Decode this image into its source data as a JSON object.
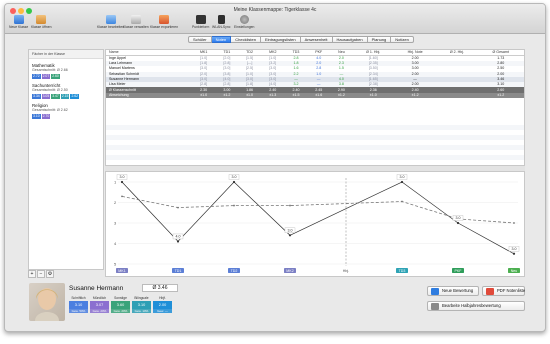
{
  "window": {
    "title": "Meine Klassenmappe: Tigerklasse 4c"
  },
  "toolbar": {
    "left": [
      "Neue Klasse",
      "Klasse öffnen"
    ],
    "middle": [
      "Klasse bearbeiten",
      "Klasse verwalten",
      "Klasse exportieren"
    ],
    "right": [
      "Punkteform",
      "WLAN-Sync",
      "Einstellungen"
    ]
  },
  "tabs": [
    "Schüler",
    "Noten",
    "Checklisten",
    "Eintragungslisten",
    "Anwesenheit",
    "Hausaufgaben",
    "Planung",
    "Notizen"
  ],
  "active_tab": "Noten",
  "sidebar": {
    "header": "Fächer in der Klasse",
    "subjects": [
      {
        "name": "Mathematik",
        "avg": "Gesamtschnitt: Ø 2.66",
        "pills": [
          "2.72",
          "2.07",
          "2.60"
        ]
      },
      {
        "name": "Sachunterricht",
        "avg": "Gesamtschnitt: Ø 2.50",
        "pills": [
          "3.34",
          "3.05",
          "3.47",
          "2.15",
          "2.62"
        ]
      },
      {
        "name": "Religion",
        "avg": "Gesamtschnitt: Ø 2.62",
        "pills": [
          "3.10",
          "2.70"
        ]
      }
    ],
    "footer_buttons": [
      "+",
      "−",
      "⚙"
    ]
  },
  "grid": {
    "columns": [
      "Name",
      "MK1",
      "TD1",
      "TD2",
      "MK2",
      "TD3",
      "PKF",
      "Neu",
      "Ø 1. Hbj.",
      "Hbj. Note",
      "Ø 2. Hbj.",
      "Ø Gesamt"
    ],
    "rows": [
      [
        "Inge Appel",
        "[1.0]",
        "[2.0]",
        "[1.5]",
        "[1.0]",
        "2.8",
        "4.0",
        "2.0",
        "[1.60]",
        "2.00",
        "",
        "1.73"
      ],
      [
        "Lara Lehmann",
        "[1.8]",
        "[2.8]",
        "[—]",
        "[3.2]",
        "1.8",
        "2.0",
        "2.3",
        "[2.35]",
        "3.00",
        "",
        "2.80"
      ],
      [
        "Manuel Martens",
        "[3.0]",
        "[3.0]",
        "[2.5]",
        "[3.0]",
        "1.6",
        "2.8",
        "1.5",
        "[3.50]",
        "3.00",
        "",
        "2.50"
      ],
      [
        "Sebastian Schmidt",
        "[2.0]",
        "[3.8]",
        "[1.0]",
        "[3.0]",
        "2.2",
        "1.0",
        "—",
        "[2.34]",
        "2.00",
        "",
        "2.00"
      ],
      [
        "Susanne Hermann",
        "[3.0]",
        "[4.0]",
        "[3.0]",
        "[3.0]",
        "—",
        "—",
        "4.0",
        "[1.65]",
        "—",
        "",
        "3.46"
      ],
      [
        "Lisa Meier",
        "[2.8]",
        "[2.8]",
        "[1.8]",
        "[4.0]",
        "3.2",
        "—",
        "3.8",
        "[2.38]",
        "2.00",
        "",
        "3.10"
      ]
    ],
    "stat_rows": [
      [
        "Ø Klassenschnitt",
        "2.30",
        "3.00",
        "1.86",
        "2.40",
        "2.40",
        "2.45",
        "2.90",
        "2.36",
        "2.40",
        "",
        "2.60"
      ],
      [
        "Abweichung",
        "±1.0",
        "±1.2",
        "±1.0",
        "±1.3",
        "±1.5",
        "±1.6",
        "±1.2",
        "±1.0",
        "±1.2",
        "",
        "±1.2"
      ]
    ]
  },
  "chart_data": {
    "type": "line",
    "categories": [
      "MK1",
      "TD1",
      "TD2",
      "MK2",
      "Hbj.",
      "TD3",
      "PKF",
      "Neu"
    ],
    "series": [
      {
        "name": "",
        "values": [
          1.0,
          3.9,
          1.0,
          3.6,
          null,
          1.0,
          3.0,
          4.5
        ]
      },
      {
        "name": "",
        "values": [
          1.7,
          2.25,
          2.15,
          2.15,
          null,
          1.95,
          2.8,
          3.0
        ]
      }
    ],
    "point_labels": [
      "3.0",
      "4.0",
      "3.0",
      "3.0",
      "",
      "3.0",
      "3.0",
      "3.0"
    ],
    "y_ticks": [
      "1",
      "2",
      "3",
      "4",
      "5"
    ],
    "ylim": [
      1,
      5
    ],
    "inverted_y": true,
    "category_colors": [
      "#7b7fc4",
      "#5c7fd6",
      "#5c7fd6",
      "#7b7fc4",
      "",
      "#2ea3b5",
      "#2e9d5a",
      "#4caf50"
    ]
  },
  "student": {
    "name": "Susanne Hermann",
    "average": "Ø 3.46",
    "tiles": [
      {
        "label": "Schriftlich",
        "value": "3.10",
        "sub": "Gew. 50%",
        "color": "#4b7fe0"
      },
      {
        "label": "Mündlich",
        "value": "3.07",
        "sub": "Gew. 20%",
        "color": "#8b6fd0"
      },
      {
        "label": "Sonstige",
        "value": "3.60",
        "sub": "Gew. 20%",
        "color": "#3aa37a"
      },
      {
        "label": "Bilinguale",
        "value": "3.10",
        "sub": "Gew. 10%",
        "color": "#2e9fb5"
      },
      {
        "label": "Hbjf.",
        "value": "2.00",
        "sub": "Gew. —",
        "color": "#1f8fd8"
      }
    ]
  },
  "actions": {
    "new_rating": "Neue Bewertung",
    "pdf_sheet": "PDF Notenliste",
    "half_year": "Bearbeite Halbjahresbewertung"
  }
}
